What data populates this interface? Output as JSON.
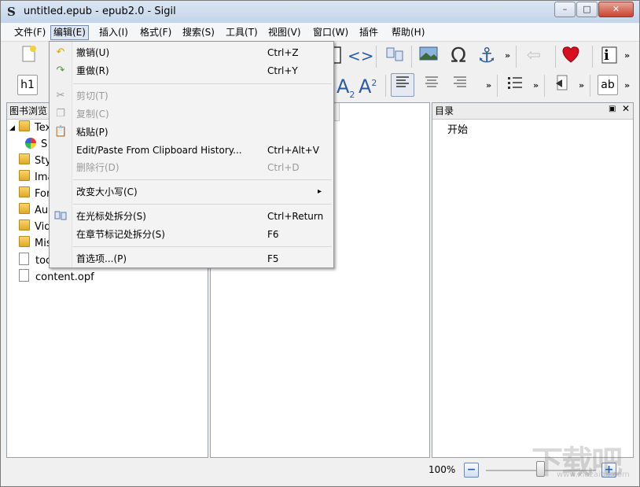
{
  "window": {
    "title": "untitled.epub - epub2.0 - Sigil",
    "app_icon": "S",
    "min": "–",
    "max": "□",
    "close": "✕"
  },
  "menubar": {
    "items": [
      "文件(F)",
      "编辑(E)",
      "插入(I)",
      "格式(F)",
      "搜索(S)",
      "工具(T)",
      "视图(V)",
      "窗口(W)",
      "插件",
      "帮助(H)"
    ],
    "active_index": 1
  },
  "toolbar": {
    "code_view": "<>",
    "omega": "Ω",
    "anchor": "⚓",
    "h1": "h1",
    "subscript_a": "A",
    "subscript_2": "2",
    "superscript_a": "A",
    "superscript_2": "2",
    "ab": "ab",
    "info": "i",
    "overflow": "»"
  },
  "book_browser": {
    "title": "图书浏览",
    "items": [
      {
        "label": "Tex",
        "type": "folder",
        "expanded": true
      },
      {
        "label": "S",
        "type": "special"
      },
      {
        "label": "Sty",
        "type": "folder"
      },
      {
        "label": "Ima",
        "type": "folder"
      },
      {
        "label": "For",
        "type": "folder"
      },
      {
        "label": "Au",
        "type": "folder"
      },
      {
        "label": "Vid",
        "type": "folder"
      },
      {
        "label": "Mis",
        "type": "folder"
      },
      {
        "label": "toc",
        "type": "file"
      },
      {
        "label": "content.opf",
        "type": "file"
      }
    ]
  },
  "toc_panel": {
    "title": "目录",
    "items": [
      "开始"
    ],
    "float_icon": "🗗",
    "close_icon": "✕"
  },
  "edit_menu": {
    "items": [
      {
        "label": "撤销(U)",
        "shortcut": "Ctrl+Z",
        "icon": "undo-icon",
        "disabled": false
      },
      {
        "label": "重做(R)",
        "shortcut": "Ctrl+Y",
        "icon": "redo-icon",
        "disabled": false
      },
      {
        "label": "剪切(T)",
        "shortcut": "",
        "icon": "scissors-icon",
        "disabled": true
      },
      {
        "label": "复制(C)",
        "shortcut": "",
        "icon": "copy-icon",
        "disabled": true
      },
      {
        "label": "粘贴(P)",
        "shortcut": "",
        "icon": "paste-icon",
        "disabled": false
      },
      {
        "label": "Edit/Paste From Clipboard History...",
        "shortcut": "Ctrl+Alt+V",
        "icon": "",
        "disabled": false
      },
      {
        "label": "删除行(D)",
        "shortcut": "Ctrl+D",
        "icon": "",
        "disabled": true
      },
      {
        "label": "改变大小写(C)",
        "shortcut": "",
        "icon": "",
        "disabled": false,
        "submenu": true
      },
      {
        "label": "在光标处拆分(S)",
        "shortcut": "Ctrl+Return",
        "icon": "split-icon",
        "disabled": false
      },
      {
        "label": "在章节标记处拆分(S)",
        "shortcut": "F6",
        "icon": "",
        "disabled": false
      },
      {
        "label": "首选项...(P)",
        "shortcut": "F5",
        "icon": "",
        "disabled": false
      }
    ],
    "submenu_arrow": "▸"
  },
  "statusbar": {
    "zoom": "100%",
    "zoom_out": "−",
    "zoom_in": "+",
    "zoom_level": 1.0
  },
  "watermark": {
    "text": "下载吧",
    "url": "www.xiazaiba.com"
  },
  "colors": {
    "accent": "#2b5aa8",
    "close_button": "#c8442f",
    "heart": "#d8101e"
  }
}
